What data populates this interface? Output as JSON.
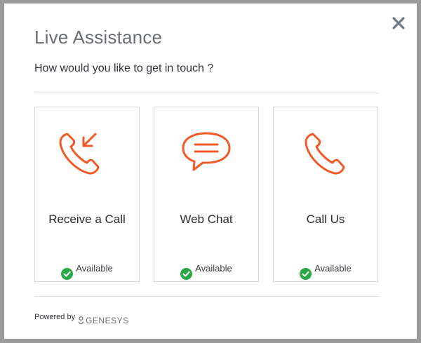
{
  "dialog": {
    "title": "Live Assistance",
    "subtitle": "How would you like to get in touch ?",
    "close_icon": "close-icon"
  },
  "options": [
    {
      "label": "Receive a Call",
      "icon": "phone-incoming-icon",
      "status": "Available"
    },
    {
      "label": "Web Chat",
      "icon": "chat-bubble-icon",
      "status": "Available"
    },
    {
      "label": "Call Us",
      "icon": "phone-icon",
      "status": "Available"
    }
  ],
  "footer": {
    "powered_by": "Powered by",
    "brand": "GENESYS"
  },
  "colors": {
    "accent": "#f05a28",
    "available": "#2aa847",
    "close": "#6f7a88"
  }
}
